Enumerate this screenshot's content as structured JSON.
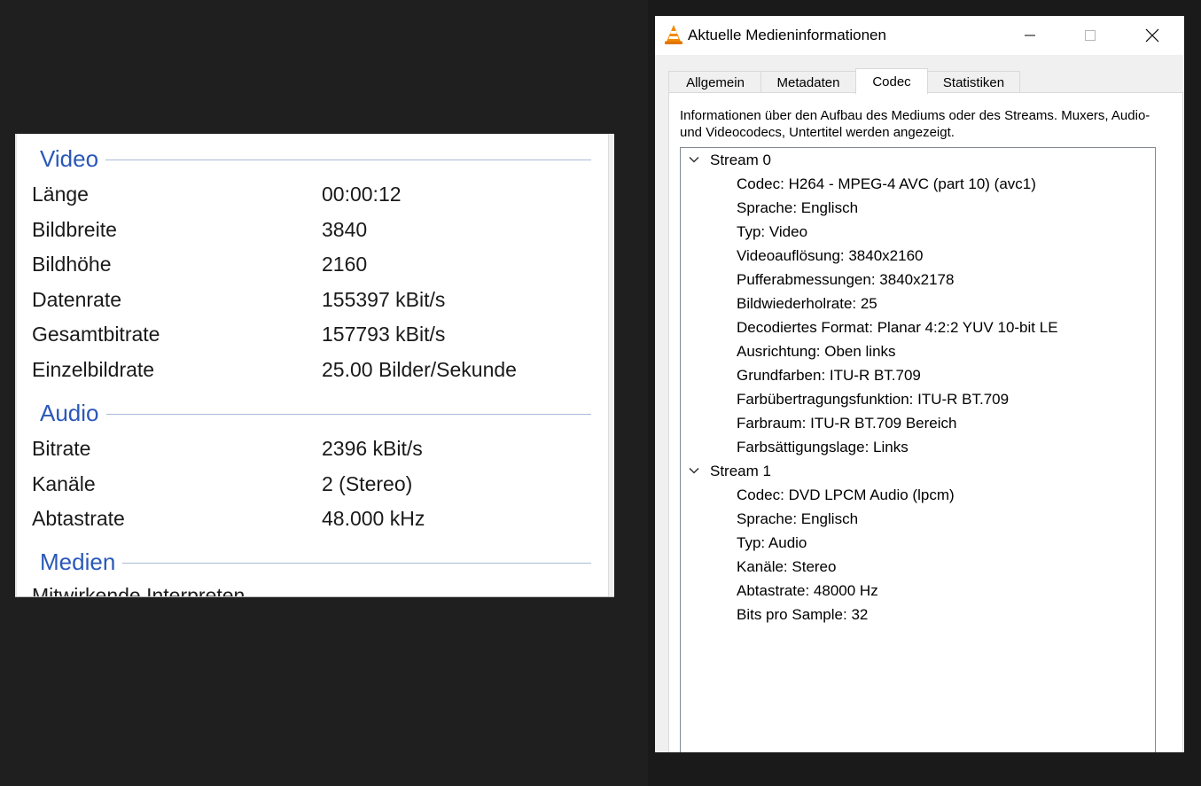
{
  "properties": {
    "video": {
      "title": "Video",
      "rows": [
        {
          "key": "Länge",
          "value": "00:00:12"
        },
        {
          "key": "Bildbreite",
          "value": "3840"
        },
        {
          "key": "Bildhöhe",
          "value": "2160"
        },
        {
          "key": "Datenrate",
          "value": "155397 kBit/s"
        },
        {
          "key": "Gesamtbitrate",
          "value": "157793 kBit/s"
        },
        {
          "key": "Einzelbildrate",
          "value": "25.00 Bilder/Sekunde"
        }
      ]
    },
    "audio": {
      "title": "Audio",
      "rows": [
        {
          "key": "Bitrate",
          "value": "2396 kBit/s"
        },
        {
          "key": "Kanäle",
          "value": "2 (Stereo)"
        },
        {
          "key": "Abtastrate",
          "value": "48.000 kHz"
        }
      ]
    },
    "media": {
      "title": "Medien",
      "cut_text": "Mitwirkende Interpreten"
    }
  },
  "dialog": {
    "title": "Aktuelle Medieninformationen",
    "tabs": [
      {
        "label": "Allgemein"
      },
      {
        "label": "Metadaten"
      },
      {
        "label": "Codec"
      },
      {
        "label": "Statistiken"
      }
    ],
    "active_tab": "Codec",
    "description": "Informationen über den Aufbau des Mediums oder des Streams. Muxers, Audio- und Videocodecs, Untertitel werden angezeigt.",
    "streams": [
      {
        "label": "Stream 0",
        "items": [
          "Codec: H264 - MPEG-4 AVC (part 10) (avc1)",
          "Sprache: Englisch",
          "Typ: Video",
          "Videoauflösung: 3840x2160",
          "Pufferabmessungen: 3840x2178",
          "Bildwiederholrate: 25",
          "Decodiertes Format: Planar 4:2:2 YUV 10-bit LE",
          "Ausrichtung: Oben links",
          "Grundfarben: ITU-R BT.709",
          "Farbübertragungsfunktion: ITU-R BT.709",
          "Farbraum: ITU-R BT.709 Bereich",
          "Farbsättigungslage: Links"
        ]
      },
      {
        "label": "Stream 1",
        "items": [
          "Codec: DVD LPCM Audio (lpcm)",
          "Sprache: Englisch",
          "Typ: Audio",
          "Kanäle: Stereo",
          "Abtastrate: 48000 Hz",
          "Bits pro Sample: 32"
        ]
      }
    ]
  },
  "colors": {
    "section_title": "#2a58b8",
    "vlc_orange": "#f28a00"
  },
  "icons": {
    "app": "vlc-cone-icon",
    "minimize": "minimize-icon",
    "maximize": "maximize-icon",
    "close": "close-icon",
    "expand": "chevron-down-icon"
  }
}
